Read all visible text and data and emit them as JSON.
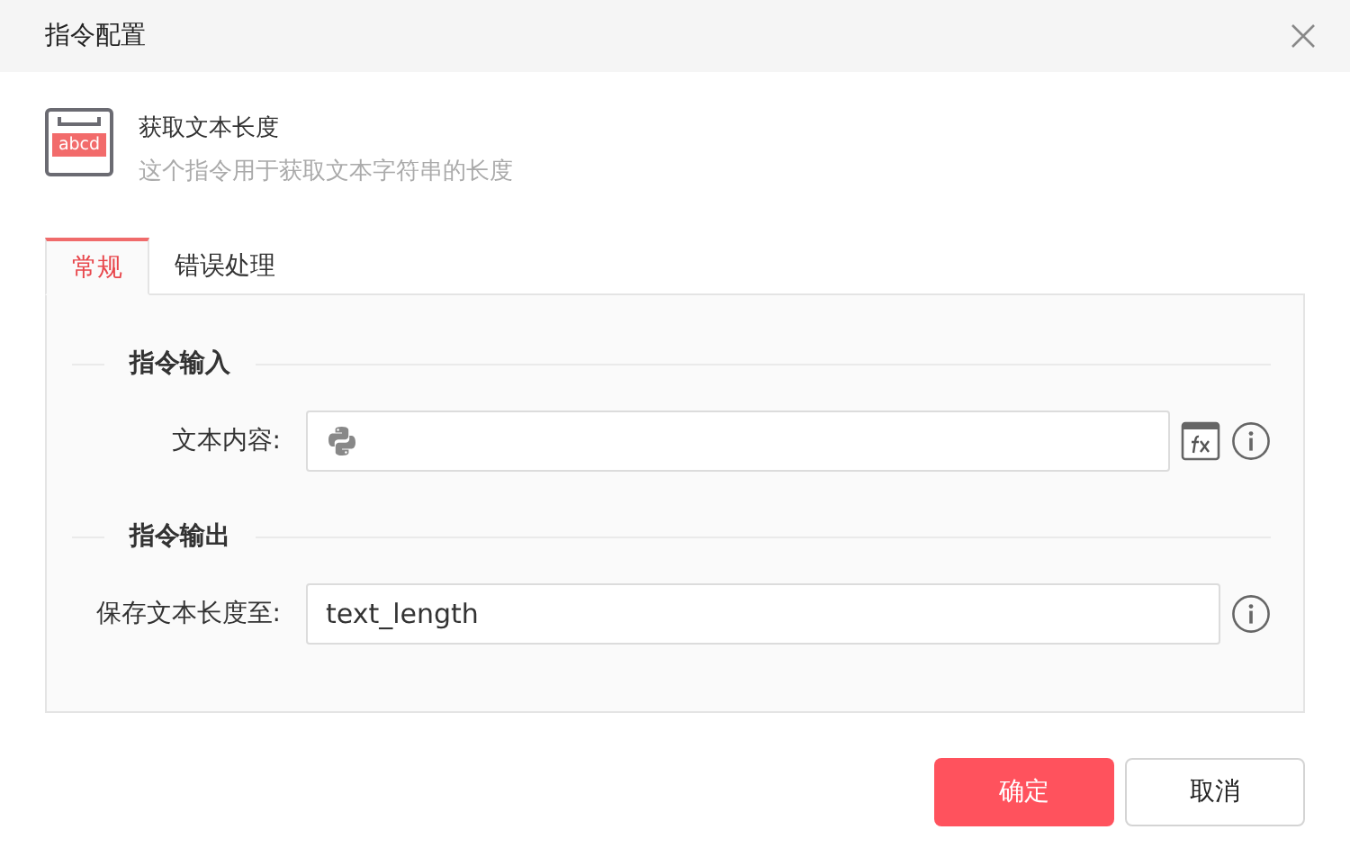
{
  "window": {
    "title": "指令配置"
  },
  "command": {
    "icon_text": "abcd",
    "name": "获取文本长度",
    "description": "这个指令用于获取文本字符串的长度"
  },
  "tabs": [
    {
      "label": "常规",
      "selected": true
    },
    {
      "label": "错误处理",
      "selected": false
    }
  ],
  "sections": [
    {
      "title": "指令输入",
      "fields": [
        {
          "kind": "expression",
          "label": "文本内容:"
        }
      ]
    },
    {
      "title": "指令输出",
      "fields": [
        {
          "kind": "plain",
          "label": "保存文本长度至:",
          "value": "text_length"
        }
      ]
    }
  ],
  "buttons": [
    {
      "label": "确定",
      "kind": "primary"
    },
    {
      "label": "取消",
      "kind": "secondary"
    }
  ]
}
